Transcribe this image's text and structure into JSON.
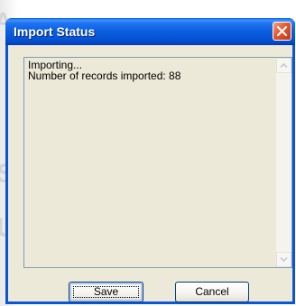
{
  "window": {
    "title": "Import Status",
    "close_icon": "close-icon"
  },
  "log": {
    "lines": [
      "Importing...",
      "Number of records imported: 88"
    ]
  },
  "buttons": {
    "save_label": "Save",
    "cancel_label": "Cancel"
  },
  "colors": {
    "titlebar": "#0a5fdc",
    "close_button": "#e5572e",
    "dialog_face": "#ece9d8"
  }
}
